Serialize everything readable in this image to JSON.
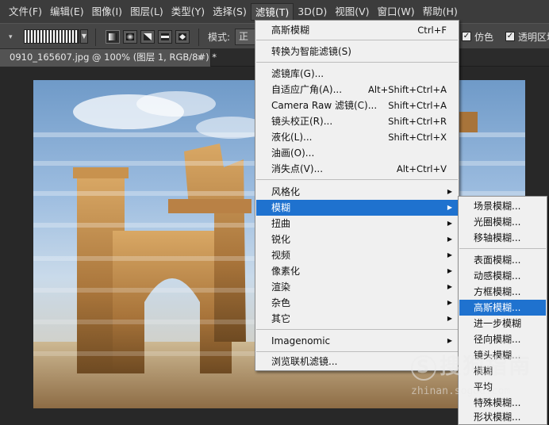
{
  "menubar": {
    "items": [
      "文件(F)",
      "编辑(E)",
      "图像(I)",
      "图层(L)",
      "类型(Y)",
      "选择(S)",
      "滤镜(T)",
      "3D(D)",
      "视图(V)",
      "窗口(W)",
      "帮助(H)"
    ],
    "active_index": 6
  },
  "options": {
    "mode_label": "模式:",
    "mode_value": "正常",
    "checkbox1_label": "仿色",
    "checkbox2_label": "透明区域"
  },
  "document": {
    "tab_title": "0910_165607.jpg @ 100% (图层 1, RGB/8#) *",
    "close_glyph": "×"
  },
  "filter_menu": {
    "last_filter": {
      "label": "高斯模糊",
      "shortcut": "Ctrl+F"
    },
    "smart": "转换为智能滤镜(S)",
    "gallery_group": [
      {
        "label": "滤镜库(G)...",
        "shortcut": ""
      },
      {
        "label": "自适应广角(A)...",
        "shortcut": "Alt+Shift+Ctrl+A"
      },
      {
        "label": "Camera Raw 滤镜(C)...",
        "shortcut": "Shift+Ctrl+A"
      },
      {
        "label": "镜头校正(R)...",
        "shortcut": "Shift+Ctrl+R"
      },
      {
        "label": "液化(L)...",
        "shortcut": "Shift+Ctrl+X"
      },
      {
        "label": "油画(O)...",
        "shortcut": ""
      },
      {
        "label": "消失点(V)...",
        "shortcut": "Alt+Ctrl+V"
      }
    ],
    "sub_group": [
      "风格化",
      "模糊",
      "扭曲",
      "锐化",
      "视频",
      "像素化",
      "渲染",
      "杂色",
      "其它"
    ],
    "highlighted": "模糊",
    "plugin": "Imagenomic",
    "browse": "浏览联机滤镜..."
  },
  "blur_submenu": {
    "group1": [
      "场景模糊...",
      "光圈模糊...",
      "移轴模糊..."
    ],
    "group2": [
      "表面模糊...",
      "动感模糊...",
      "方框模糊...",
      "高斯模糊...",
      "进一步模糊",
      "径向模糊...",
      "镜头模糊...",
      "模糊",
      "平均",
      "特殊模糊...",
      "形状模糊..."
    ],
    "highlighted": "高斯模糊..."
  },
  "watermark": {
    "logo_glyph": "S",
    "text": "搜狗指南",
    "domain": "zhinan.sogou.com"
  },
  "colors": {
    "menu_highlight": "#1f72cf",
    "app_bg": "#282828",
    "menubar_bg": "#3c3c3c"
  }
}
